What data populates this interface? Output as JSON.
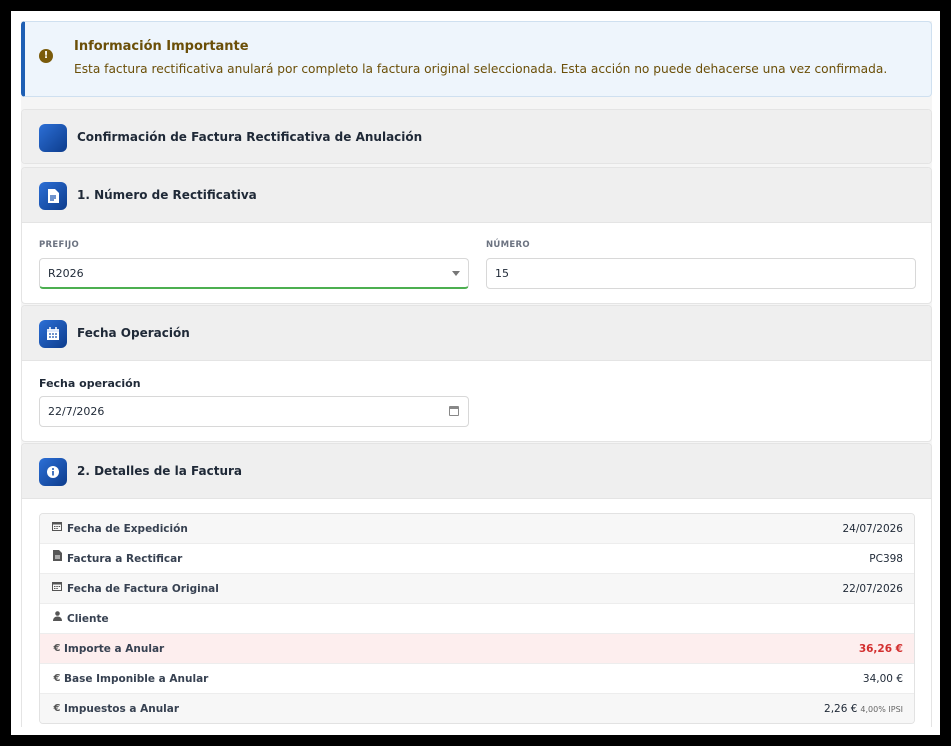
{
  "alert": {
    "title": "Información Importante",
    "text": "Esta factura rectificativa anulará por completo la factura original seleccionada. Esta acción no puede dehacerse una vez confirmada."
  },
  "confirm_header": {
    "title": "Confirmación de Factura Rectificativa de Anulación"
  },
  "numero_section": {
    "title": "1. Número de Rectificativa",
    "prefijo_label": "PREFIJO",
    "prefijo_value": "R2026",
    "numero_label": "NÚMERO",
    "numero_value": "15"
  },
  "fecha_section": {
    "title": "Fecha Operación",
    "field_label": "Fecha operación",
    "field_value": "22/7/2026"
  },
  "detalles_section": {
    "title": "2. Detalles de la Factura",
    "rows": [
      {
        "icon": "calendar-icon",
        "label": "Fecha de Expedición",
        "value": "24/07/2026"
      },
      {
        "icon": "document-icon",
        "label": "Factura a Rectificar",
        "value": "PC398"
      },
      {
        "icon": "calendar-icon",
        "label": "Fecha de Factura Original",
        "value": "22/07/2026"
      },
      {
        "icon": "user-icon",
        "label": "Cliente",
        "value": ""
      },
      {
        "icon": "euro-icon",
        "label": "Importe a Anular",
        "value": "36,26 €"
      },
      {
        "icon": "euro-icon",
        "label": "Base Imponible a Anular",
        "value": "34,00 €"
      },
      {
        "icon": "euro-icon",
        "label": "Impuestos a Anular",
        "value": "2,26 €",
        "suffix": "4,00% IPSI"
      }
    ]
  },
  "colors": {
    "accent": "#1e5fb4",
    "warning_text": "#6b4f08",
    "alert_bg": "#eef5fc",
    "highlight_bg": "#fdeeee",
    "highlight_text": "#d32f2f",
    "select_focus": "#4caf50"
  }
}
